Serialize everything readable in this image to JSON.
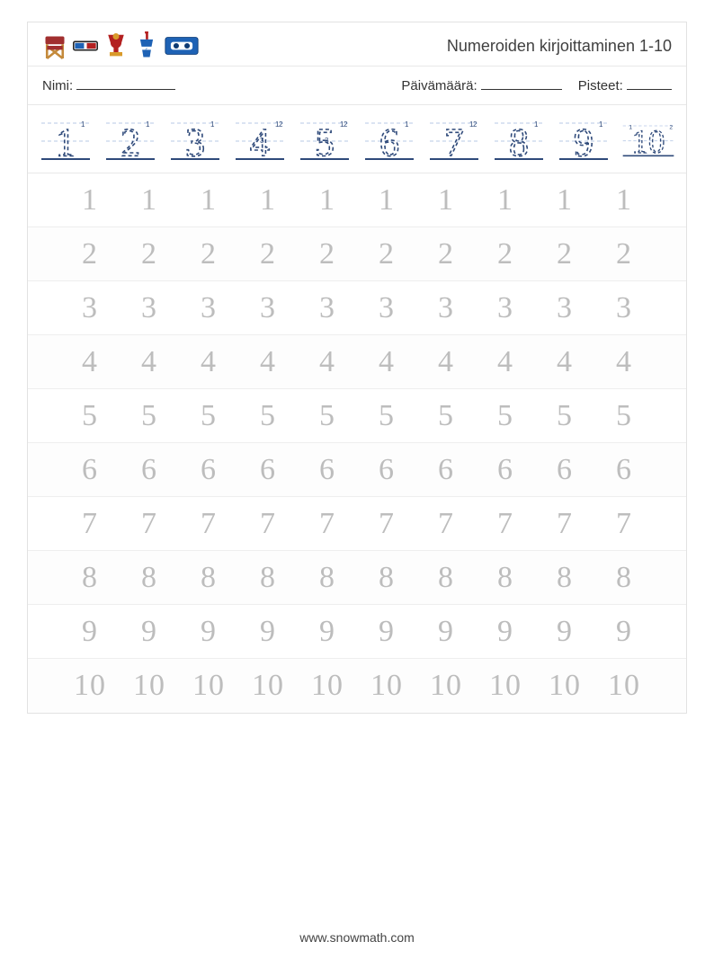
{
  "title": "Numeroiden kirjoittaminen 1-10",
  "meta": {
    "name_label": "Nimi:",
    "date_label": "Päivämäärä:",
    "score_label": "Pisteet:"
  },
  "guide_numbers": [
    "1",
    "2",
    "3",
    "4",
    "5",
    "6",
    "7",
    "8",
    "9",
    "10"
  ],
  "rows": [
    {
      "digit": "1",
      "repeat": 10
    },
    {
      "digit": "2",
      "repeat": 10
    },
    {
      "digit": "3",
      "repeat": 10
    },
    {
      "digit": "4",
      "repeat": 10
    },
    {
      "digit": "5",
      "repeat": 10
    },
    {
      "digit": "6",
      "repeat": 10
    },
    {
      "digit": "7",
      "repeat": 10
    },
    {
      "digit": "8",
      "repeat": 10
    },
    {
      "digit": "9",
      "repeat": 10
    },
    {
      "digit": "10",
      "repeat": 10
    }
  ],
  "icons": [
    "director-chair-icon",
    "3d-glasses-icon",
    "trophy-icon",
    "soda-cup-icon",
    "vhs-tape-icon"
  ],
  "footer": "www.snowmath.com"
}
